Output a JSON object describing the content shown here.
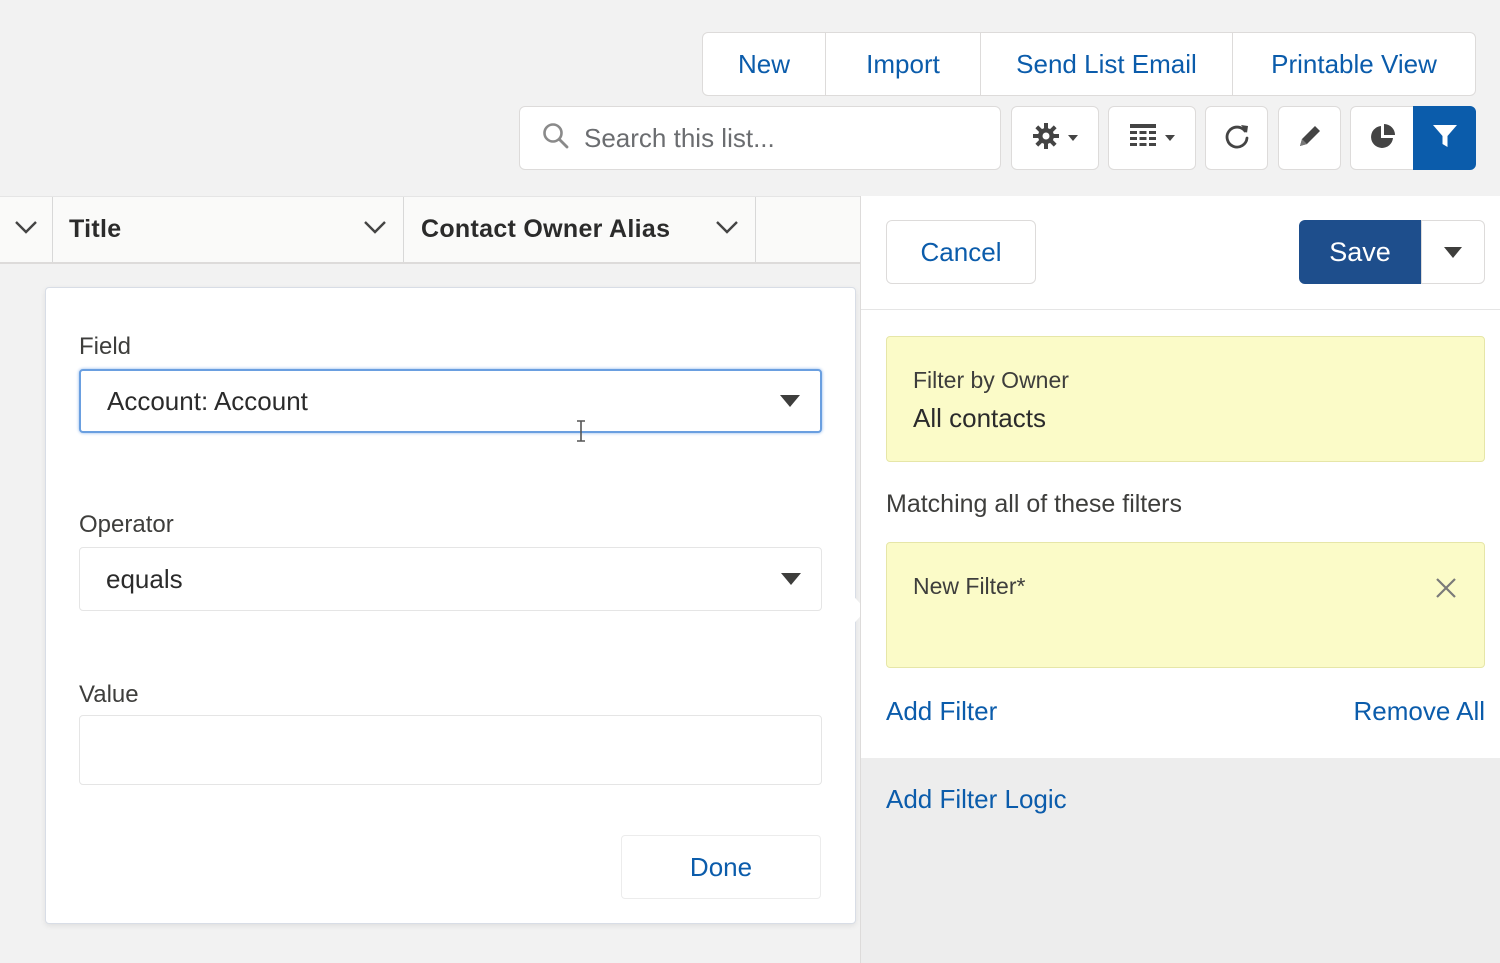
{
  "toolbar": {
    "actions": [
      "New",
      "Import",
      "Send List Email",
      "Printable View"
    ],
    "search_placeholder": "Search this list..."
  },
  "table": {
    "columns": [
      "Title",
      "Contact Owner Alias"
    ]
  },
  "filter_editor": {
    "field_label": "Field",
    "field_value": "Account: Account",
    "operator_label": "Operator",
    "operator_value": "equals",
    "value_label": "Value",
    "value_value": "",
    "done_label": "Done"
  },
  "filter_panel": {
    "cancel_label": "Cancel",
    "save_label": "Save",
    "owner_filter_title": "Filter by Owner",
    "owner_filter_value": "All contacts",
    "matching_heading": "Matching all of these filters",
    "new_filter_title": "New Filter*",
    "add_filter_label": "Add Filter",
    "remove_all_label": "Remove All",
    "add_filter_logic_label": "Add Filter Logic"
  },
  "colors": {
    "link_blue": "#0b5cab",
    "save_blue": "#1e4e8c",
    "filter_card_yellow": "#fbfbc8"
  }
}
